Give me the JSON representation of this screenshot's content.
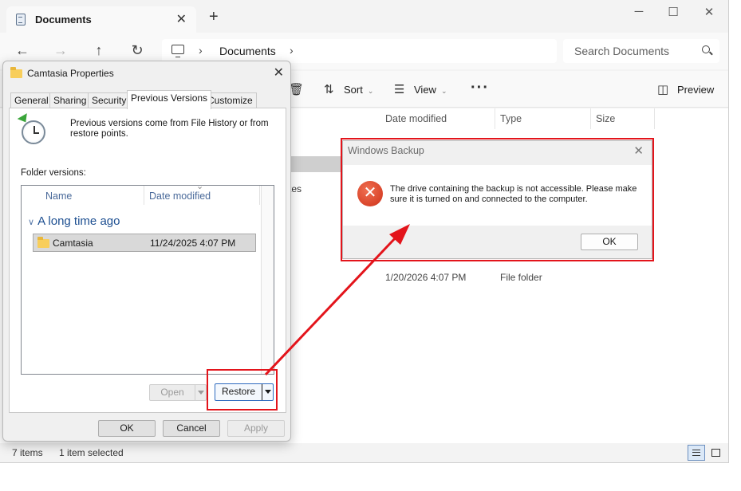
{
  "explorer": {
    "tab_title": "Documents",
    "new_tab": "+",
    "window_controls": {
      "minimize": "─",
      "maximize": "☐",
      "close": "✕"
    },
    "nav": {
      "back": "←",
      "forward": "→",
      "up": "↑",
      "refresh": "↻"
    },
    "breadcrumb": {
      "sep1": "›",
      "crumb": "Documents",
      "sep2": "›"
    },
    "search_placeholder": "Search Documents",
    "commands": {
      "delete_icon": "🗑",
      "sort_icon": "⇅",
      "sort": "Sort",
      "view_icon": "☰",
      "view": "View",
      "more": "···",
      "preview_icon": "◫",
      "preview": "Preview",
      "chevron": "⌄"
    },
    "columns": {
      "date_modified": "Date modified",
      "type": "Type",
      "size": "Size"
    },
    "row_fragment": "tes",
    "row": {
      "date": "1/20/2026 4:07 PM",
      "type": "File folder"
    },
    "status": {
      "items": "7 items",
      "selected": "1 item selected"
    }
  },
  "properties": {
    "title": "Camtasia Properties",
    "close": "✕",
    "tabs": [
      "General",
      "Sharing",
      "Security",
      "Previous Versions",
      "Customize"
    ],
    "description": "Previous versions come from File History or from restore points.",
    "folder_versions_label": "Folder versions:",
    "list_headers": {
      "name": "Name",
      "date_modified": "Date modified",
      "sort_indicator": "⌄"
    },
    "group_label": "A long time ago",
    "group_chevron": "∨",
    "item": {
      "name": "Camtasia",
      "date": "11/24/2025 4:07 PM"
    },
    "open_button": "Open",
    "restore_button": "Restore",
    "ok": "OK",
    "cancel": "Cancel",
    "apply": "Apply"
  },
  "backup": {
    "title": "Windows Backup",
    "close": "✕",
    "error_glyph": "✕",
    "message": "The drive containing the backup is not accessible. Please make sure it is turned on and connected to the computer.",
    "ok": "OK"
  },
  "colors": {
    "annotation_red": "#e3141b",
    "error_red": "#d9442a",
    "group_blue": "#1d4f91"
  }
}
